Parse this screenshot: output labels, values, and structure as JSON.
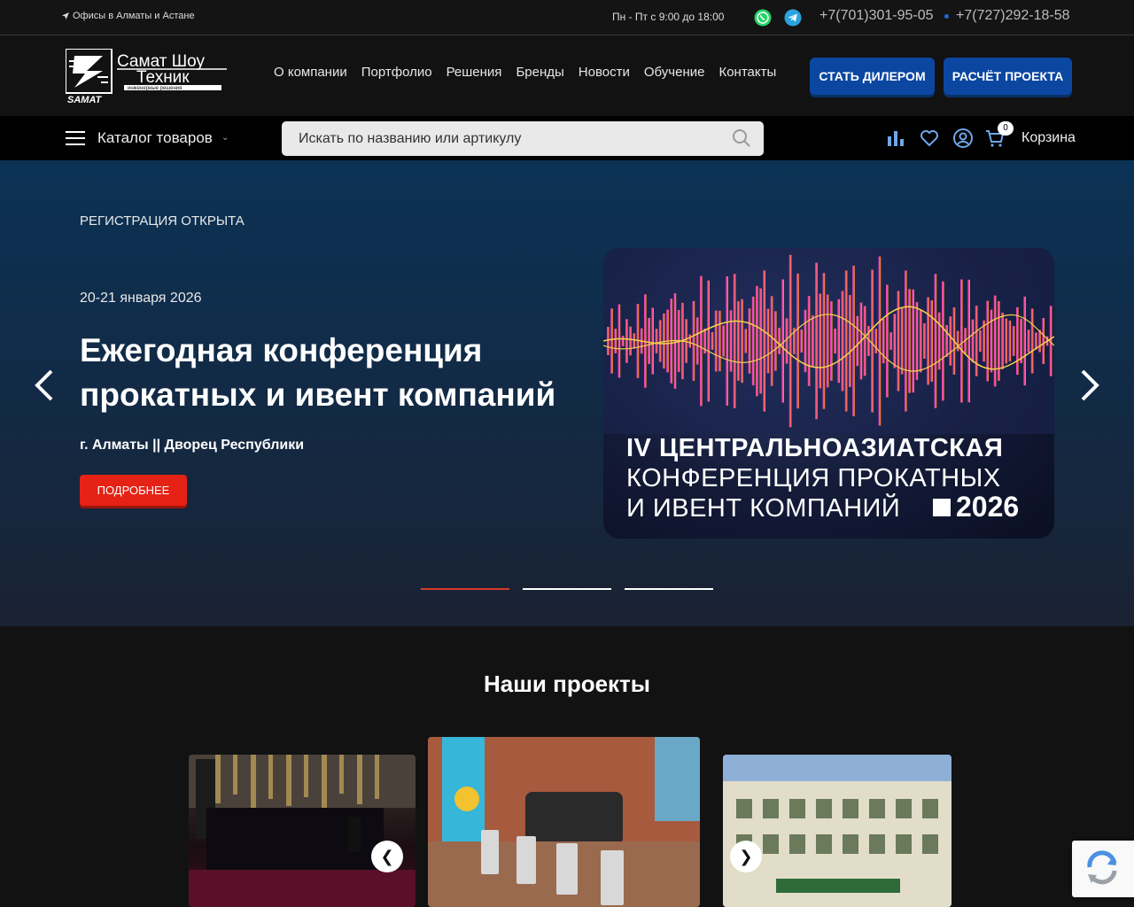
{
  "topbar": {
    "offices": "Офисы в Алматы и Астане",
    "hours": "Пн - Пт с 9:00 до 18:00",
    "phone1": "+7(701)301-95-05",
    "phone2": "+7(727)292-18-58"
  },
  "header": {
    "logo_alt": "Самат Шоу Техник инженерные решения",
    "nav": [
      "О компании",
      "Портфолио",
      "Решения",
      "Бренды",
      "Новости",
      "Обучение",
      "Контакты"
    ],
    "btn_dealer": "СТАТЬ ДИЛЕРОМ",
    "btn_calc": "РАСЧЁТ ПРОЕКТА"
  },
  "catbar": {
    "catalog_label": "Каталог товаров",
    "search_placeholder": "Искать по названию или артикулу",
    "cart_count": "0",
    "cart_label": "Корзина"
  },
  "hero": {
    "registration": "РЕГИСТРАЦИЯ ОТКРЫТА",
    "date": "20-21 января 2026",
    "title": "Ежегодная конференция прокатных и ивент компаний",
    "location": "г. Алматы || Дворец Республики",
    "more_button": "ПОДРОБНЕЕ",
    "banner": {
      "line1": "IV ЦЕНТРАЛЬНОАЗИАТСКАЯ",
      "line2": "КОНФЕРЕНЦИЯ ПРОКАТНЫХ",
      "line3": "И ИВЕНТ КОМПАНИЙ",
      "year": "2026"
    },
    "slides": 3,
    "active_slide": 0
  },
  "projects": {
    "title": "Наши проекты",
    "prev": "❮",
    "next": "❯"
  },
  "colors": {
    "accent_blue": "#0b47a1",
    "accent_red": "#e52215",
    "background": "#121212"
  }
}
